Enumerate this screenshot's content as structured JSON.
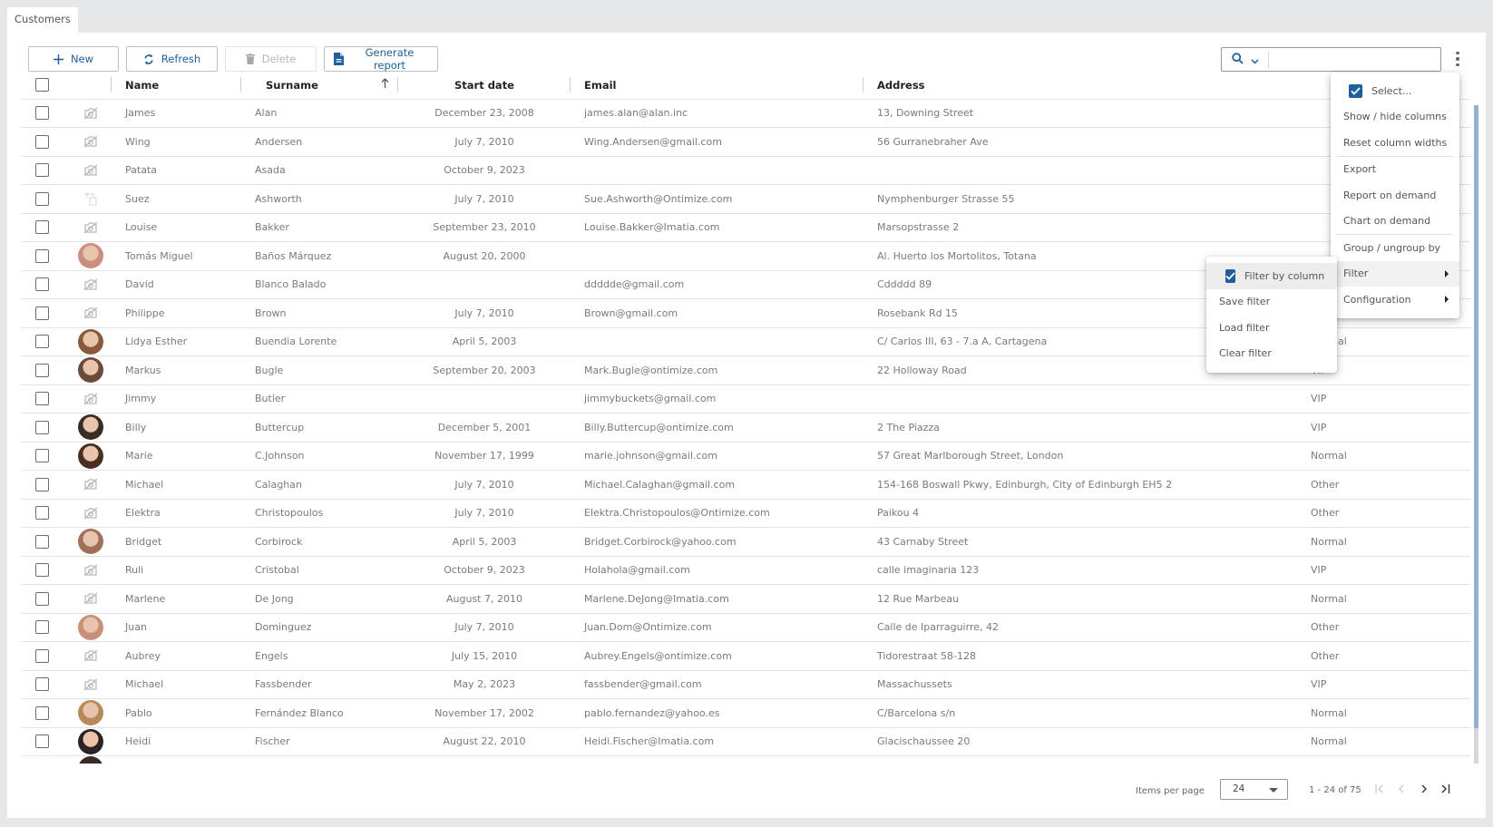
{
  "tab": {
    "label": "Customers"
  },
  "toolbar": {
    "new_label": "New",
    "refresh_label": "Refresh",
    "delete_label": "Delete",
    "report_label": "Generate report"
  },
  "search": {
    "value": "",
    "placeholder": ""
  },
  "colors": {
    "accent": "#1f5f9c",
    "scroll_thumb": "#8fb1d2"
  },
  "table": {
    "columns": {
      "name": "Name",
      "surname": "Surname",
      "start_date": "Start date",
      "email": "Email",
      "address": "Address"
    },
    "sort": {
      "column": "Surname",
      "direction": "ascending"
    },
    "rows": [
      {
        "photo": "no-image",
        "name": "James",
        "surname": "Alan",
        "start_date": "December 23, 2008",
        "email": "james.alan@alan.inc",
        "address": "13, Downing Street",
        "type": ""
      },
      {
        "photo": "no-image",
        "name": "Wing",
        "surname": "Andersen",
        "start_date": "July 7, 2010",
        "email": "Wing.Andersen@gmail.com",
        "address": "56 Gurranebraher Ave",
        "type": ""
      },
      {
        "photo": "no-image",
        "name": "Patata",
        "surname": "Asada",
        "start_date": "October 9, 2023",
        "email": "",
        "address": "",
        "type": ""
      },
      {
        "photo": "broken-image",
        "name": "Suez",
        "surname": "Ashworth",
        "start_date": "July 7, 2010",
        "email": "Sue.Ashworth@Ontimize.com",
        "address": "Nymphenburger Strasse 55",
        "type": ""
      },
      {
        "photo": "no-image",
        "name": "Louise",
        "surname": "Bakker",
        "start_date": "September 23, 2010",
        "email": "Louise.Bakker@Imatia.com",
        "address": "Marsopstrasse 2",
        "type": ""
      },
      {
        "photo": "avatar",
        "avatar_color": "#c98e7c",
        "name": "Tomás Miguel",
        "surname": "Baños Márquez",
        "start_date": "August 20, 2000",
        "email": "",
        "address": "Al. Huerto los Mortolitos, Totana",
        "type": ""
      },
      {
        "photo": "no-image",
        "name": "David",
        "surname": "Blanco Balado",
        "start_date": "",
        "email": "ddddde@gmail.com",
        "address": "Cddddd 89",
        "type": ""
      },
      {
        "photo": "no-image",
        "name": "Philippe",
        "surname": "Brown",
        "start_date": "July 7, 2010",
        "email": "Brown@gmail.com",
        "address": "Rosebank Rd 15",
        "type": ""
      },
      {
        "photo": "avatar",
        "avatar_color": "#8a5a3c",
        "name": "Lidya Esther",
        "surname": "Buendia Lorente",
        "start_date": "April 5, 2003",
        "email": "",
        "address": "C/ Carlos III, 63 - 7.a A, Cartagena",
        "type": "Normal"
      },
      {
        "photo": "avatar",
        "avatar_color": "#6b4a3a",
        "name": "Markus",
        "surname": "Bugle",
        "start_date": "September 20, 2003",
        "email": "Mark.Bugle@ontimize.com",
        "address": "22 Holloway Road",
        "type": "VIP"
      },
      {
        "photo": "no-image",
        "name": "Jimmy",
        "surname": "Butler",
        "start_date": "",
        "email": "jimmybuckets@gmail.com",
        "address": "",
        "type": "VIP"
      },
      {
        "photo": "avatar",
        "avatar_color": "#3b2b25",
        "name": "Billy",
        "surname": "Buttercup",
        "start_date": "December 5, 2001",
        "email": "Billy.Buttercup@ontimize.com",
        "address": "2 The Piazza",
        "type": "VIP"
      },
      {
        "photo": "avatar",
        "avatar_color": "#4a2e22",
        "name": "Marie",
        "surname": "C.Johnson",
        "start_date": "November 17, 1999",
        "email": "marie.johnson@gmail.com",
        "address": "57 Great Marlborough Street, London",
        "type": "Normal"
      },
      {
        "photo": "no-image",
        "name": "Michael",
        "surname": "Calaghan",
        "start_date": "July 7, 2010",
        "email": "Michael.Calaghan@gmail.com",
        "address": "154-168 Boswall Pkwy, Edinburgh, City of Edinburgh EH5 2",
        "type": "Other"
      },
      {
        "photo": "no-image",
        "name": "Elektra",
        "surname": "Christopoulos",
        "start_date": "July 7, 2010",
        "email": "Elektra.Christopoulos@Ontimize.com",
        "address": "Paikou 4",
        "type": "Other"
      },
      {
        "photo": "avatar",
        "avatar_color": "#a0705a",
        "name": "Bridget",
        "surname": "Corbirock",
        "start_date": "April 5, 2003",
        "email": "Bridget.Corbirock@yahoo.com",
        "address": "43 Carnaby Street",
        "type": "Normal"
      },
      {
        "photo": "no-image",
        "name": "Ruli",
        "surname": "Cristobal",
        "start_date": "October 9, 2023",
        "email": "Holahola@gmail.com",
        "address": "calle imaginaria 123",
        "type": "VIP"
      },
      {
        "photo": "no-image",
        "name": "Marlene",
        "surname": "De Jong",
        "start_date": "August 7, 2010",
        "email": "Marlene.DeJong@Imatia.com",
        "address": "12 Rue Marbeau",
        "type": "Normal"
      },
      {
        "photo": "avatar",
        "avatar_color": "#c7907a",
        "name": "Juan",
        "surname": "Dominguez",
        "start_date": "July 7, 2010",
        "email": "Juan.Dom@Ontimize.com",
        "address": "Calle de Iparraguirre, 42",
        "type": "Other"
      },
      {
        "photo": "no-image",
        "name": "Aubrey",
        "surname": "Engels",
        "start_date": "July 15, 2010",
        "email": "Aubrey.Engels@ontimize.com",
        "address": "Tidorestraat 58-128",
        "type": "Other"
      },
      {
        "photo": "no-image",
        "name": "Michael",
        "surname": "Fassbender",
        "start_date": "May 2, 2023",
        "email": "fassbender@gmail.com",
        "address": "Massachussets",
        "type": "VIP"
      },
      {
        "photo": "avatar",
        "avatar_color": "#b78a5a",
        "name": "Pablo",
        "surname": "Fernández Blanco",
        "start_date": "November 17, 2002",
        "email": "pablo.fernandez@yahoo.es",
        "address": "C/Barcelona s/n",
        "type": "Normal"
      },
      {
        "photo": "avatar",
        "avatar_color": "#2a2225",
        "name": "Heidi",
        "surname": "Fischer",
        "start_date": "August 22, 2010",
        "email": "Heidi.Fischer@Imatia.com",
        "address": "Glacischaussee 20",
        "type": "Normal"
      }
    ]
  },
  "menu": {
    "items": [
      {
        "label": "Select...",
        "checked": true
      },
      {
        "label": "Show / hide columns"
      },
      {
        "label": "Reset column widths"
      },
      {
        "label": "Export"
      },
      {
        "label": "Report on demand"
      },
      {
        "label": "Chart on demand"
      },
      {
        "label": "Group / ungroup by"
      },
      {
        "label": "Filter",
        "submenu": true,
        "active": true
      },
      {
        "label": "Configuration",
        "submenu": true
      }
    ],
    "filter_submenu": [
      {
        "label": "Filter by column",
        "checked": true
      },
      {
        "label": "Save filter"
      },
      {
        "label": "Load filter"
      },
      {
        "label": "Clear filter"
      }
    ]
  },
  "paginator": {
    "items_per_page_label": "Items per page",
    "page_size": "24",
    "range": "1 - 24 of 75"
  }
}
